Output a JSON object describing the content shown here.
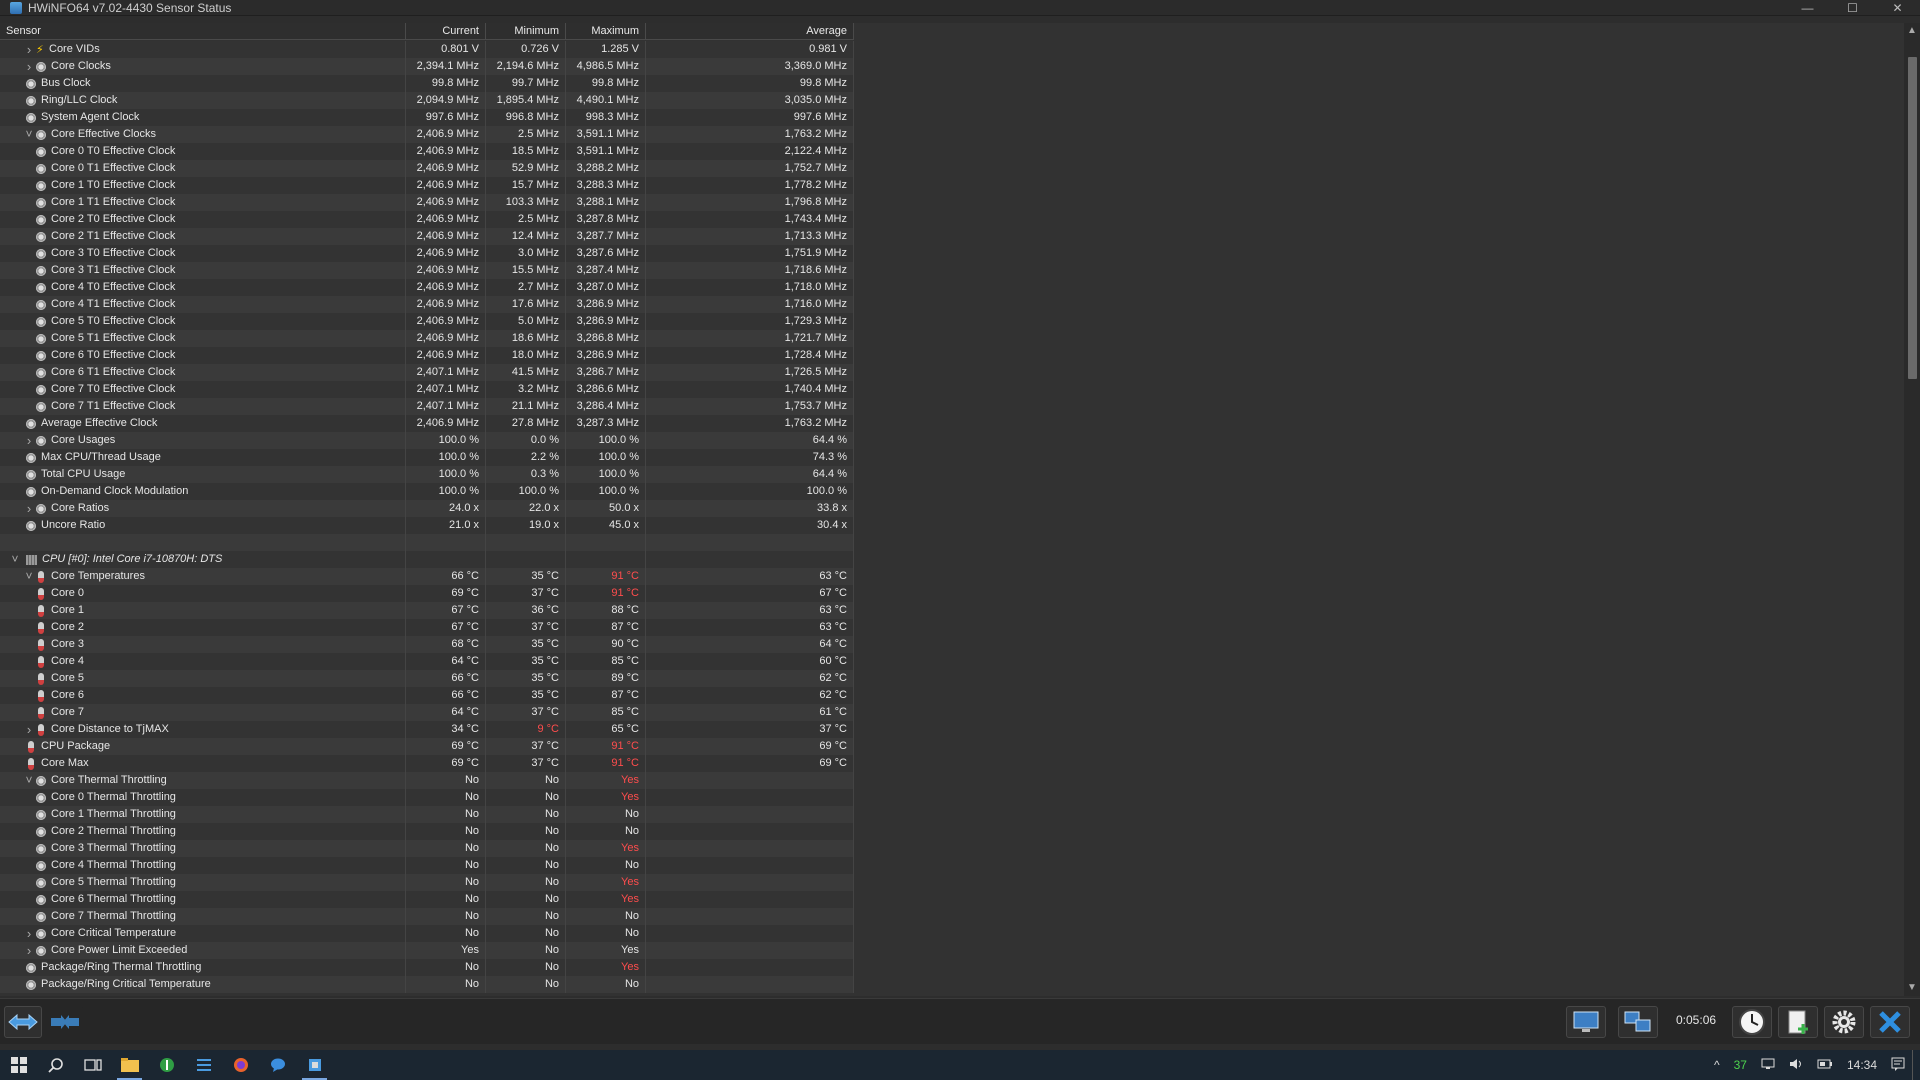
{
  "window": {
    "title": "HWiNFO64 v7.02-4430 Sensor Status",
    "minimize": "—",
    "maximize": "☐",
    "close": "✕"
  },
  "columns": [
    "Sensor",
    "Current",
    "Minimum",
    "Maximum",
    "Average"
  ],
  "rows": [
    {
      "label": "Core VIDs",
      "indent": 1,
      "expander": "right",
      "icon": "volt",
      "cur": "0.801 V",
      "min": "0.726 V",
      "max": "1.285 V",
      "avg": "0.981 V"
    },
    {
      "label": "Core Clocks",
      "indent": 1,
      "expander": "right",
      "icon": "clock",
      "cur": "2,394.1 MHz",
      "min": "2,194.6 MHz",
      "max": "4,986.5 MHz",
      "avg": "3,369.0 MHz"
    },
    {
      "label": "Bus Clock",
      "indent": 0,
      "icon": "clock",
      "cur": "99.8 MHz",
      "min": "99.7 MHz",
      "max": "99.8 MHz",
      "avg": "99.8 MHz"
    },
    {
      "label": "Ring/LLC Clock",
      "indent": 0,
      "icon": "clock",
      "cur": "2,094.9 MHz",
      "min": "1,895.4 MHz",
      "max": "4,490.1 MHz",
      "avg": "3,035.0 MHz"
    },
    {
      "label": "System Agent Clock",
      "indent": 0,
      "icon": "clock",
      "cur": "997.6 MHz",
      "min": "996.8 MHz",
      "max": "998.3 MHz",
      "avg": "997.6 MHz"
    },
    {
      "label": "Core Effective Clocks",
      "indent": 1,
      "expander": "down",
      "icon": "clock",
      "cur": "2,406.9 MHz",
      "min": "2.5 MHz",
      "max": "3,591.1 MHz",
      "avg": "1,763.2 MHz"
    },
    {
      "label": "Core 0 T0 Effective Clock",
      "indent": 2,
      "icon": "clock",
      "cur": "2,406.9 MHz",
      "min": "18.5 MHz",
      "max": "3,591.1 MHz",
      "avg": "2,122.4 MHz"
    },
    {
      "label": "Core 0 T1 Effective Clock",
      "indent": 2,
      "icon": "clock",
      "cur": "2,406.9 MHz",
      "min": "52.9 MHz",
      "max": "3,288.2 MHz",
      "avg": "1,752.7 MHz"
    },
    {
      "label": "Core 1 T0 Effective Clock",
      "indent": 2,
      "icon": "clock",
      "cur": "2,406.9 MHz",
      "min": "15.7 MHz",
      "max": "3,288.3 MHz",
      "avg": "1,778.2 MHz"
    },
    {
      "label": "Core 1 T1 Effective Clock",
      "indent": 2,
      "icon": "clock",
      "cur": "2,406.9 MHz",
      "min": "103.3 MHz",
      "max": "3,288.1 MHz",
      "avg": "1,796.8 MHz"
    },
    {
      "label": "Core 2 T0 Effective Clock",
      "indent": 2,
      "icon": "clock",
      "cur": "2,406.9 MHz",
      "min": "2.5 MHz",
      "max": "3,287.8 MHz",
      "avg": "1,743.4 MHz"
    },
    {
      "label": "Core 2 T1 Effective Clock",
      "indent": 2,
      "icon": "clock",
      "cur": "2,406.9 MHz",
      "min": "12.4 MHz",
      "max": "3,287.7 MHz",
      "avg": "1,713.3 MHz"
    },
    {
      "label": "Core 3 T0 Effective Clock",
      "indent": 2,
      "icon": "clock",
      "cur": "2,406.9 MHz",
      "min": "3.0 MHz",
      "max": "3,287.6 MHz",
      "avg": "1,751.9 MHz"
    },
    {
      "label": "Core 3 T1 Effective Clock",
      "indent": 2,
      "icon": "clock",
      "cur": "2,406.9 MHz",
      "min": "15.5 MHz",
      "max": "3,287.4 MHz",
      "avg": "1,718.6 MHz"
    },
    {
      "label": "Core 4 T0 Effective Clock",
      "indent": 2,
      "icon": "clock",
      "cur": "2,406.9 MHz",
      "min": "2.7 MHz",
      "max": "3,287.0 MHz",
      "avg": "1,718.0 MHz"
    },
    {
      "label": "Core 4 T1 Effective Clock",
      "indent": 2,
      "icon": "clock",
      "cur": "2,406.9 MHz",
      "min": "17.6 MHz",
      "max": "3,286.9 MHz",
      "avg": "1,716.0 MHz"
    },
    {
      "label": "Core 5 T0 Effective Clock",
      "indent": 2,
      "icon": "clock",
      "cur": "2,406.9 MHz",
      "min": "5.0 MHz",
      "max": "3,286.9 MHz",
      "avg": "1,729.3 MHz"
    },
    {
      "label": "Core 5 T1 Effective Clock",
      "indent": 2,
      "icon": "clock",
      "cur": "2,406.9 MHz",
      "min": "18.6 MHz",
      "max": "3,286.8 MHz",
      "avg": "1,721.7 MHz"
    },
    {
      "label": "Core 6 T0 Effective Clock",
      "indent": 2,
      "icon": "clock",
      "cur": "2,406.9 MHz",
      "min": "18.0 MHz",
      "max": "3,286.9 MHz",
      "avg": "1,728.4 MHz"
    },
    {
      "label": "Core 6 T1 Effective Clock",
      "indent": 2,
      "icon": "clock",
      "cur": "2,407.1 MHz",
      "min": "41.5 MHz",
      "max": "3,286.7 MHz",
      "avg": "1,726.5 MHz"
    },
    {
      "label": "Core 7 T0 Effective Clock",
      "indent": 2,
      "icon": "clock",
      "cur": "2,407.1 MHz",
      "min": "3.2 MHz",
      "max": "3,286.6 MHz",
      "avg": "1,740.4 MHz"
    },
    {
      "label": "Core 7 T1 Effective Clock",
      "indent": 2,
      "icon": "clock",
      "cur": "2,407.1 MHz",
      "min": "21.1 MHz",
      "max": "3,286.4 MHz",
      "avg": "1,753.7 MHz"
    },
    {
      "label": "Average Effective Clock",
      "indent": 0,
      "icon": "clock",
      "cur": "2,406.9 MHz",
      "min": "27.8 MHz",
      "max": "3,287.3 MHz",
      "avg": "1,763.2 MHz"
    },
    {
      "label": "Core Usages",
      "indent": 1,
      "expander": "right",
      "icon": "clock",
      "cur": "100.0 %",
      "min": "0.0 %",
      "max": "100.0 %",
      "avg": "64.4 %"
    },
    {
      "label": "Max CPU/Thread Usage",
      "indent": 0,
      "icon": "clock",
      "cur": "100.0 %",
      "min": "2.2 %",
      "max": "100.0 %",
      "avg": "74.3 %"
    },
    {
      "label": "Total CPU Usage",
      "indent": 0,
      "icon": "clock",
      "cur": "100.0 %",
      "min": "0.3 %",
      "max": "100.0 %",
      "avg": "64.4 %"
    },
    {
      "label": "On-Demand Clock Modulation",
      "indent": 0,
      "icon": "clock",
      "cur": "100.0 %",
      "min": "100.0 %",
      "max": "100.0 %",
      "avg": "100.0 %"
    },
    {
      "label": "Core Ratios",
      "indent": 1,
      "expander": "right",
      "icon": "clock",
      "cur": "24.0 x",
      "min": "22.0 x",
      "max": "50.0 x",
      "avg": "33.8 x"
    },
    {
      "label": "Uncore Ratio",
      "indent": 0,
      "icon": "clock",
      "cur": "21.0 x",
      "min": "19.0 x",
      "max": "45.0 x",
      "avg": "30.4 x"
    },
    {
      "label": "",
      "indent": 0,
      "icon": "none",
      "cur": "",
      "min": "",
      "max": "",
      "avg": ""
    },
    {
      "label": "CPU [#0]: Intel Core i7-10870H: DTS",
      "indent": 0,
      "expander": "down-group",
      "icon": "chip",
      "italic": true,
      "cur": "",
      "min": "",
      "max": "",
      "avg": ""
    },
    {
      "label": "Core Temperatures",
      "indent": 1,
      "expander": "down",
      "icon": "therm",
      "cur": "66 °C",
      "min": "35 °C",
      "max": "91 °C",
      "maxRed": true,
      "avg": "63 °C"
    },
    {
      "label": "Core 0",
      "indent": 2,
      "icon": "therm",
      "cur": "69 °C",
      "min": "37 °C",
      "max": "91 °C",
      "maxRed": true,
      "avg": "67 °C"
    },
    {
      "label": "Core 1",
      "indent": 2,
      "icon": "therm",
      "cur": "67 °C",
      "min": "36 °C",
      "max": "88 °C",
      "avg": "63 °C"
    },
    {
      "label": "Core 2",
      "indent": 2,
      "icon": "therm",
      "cur": "67 °C",
      "min": "37 °C",
      "max": "87 °C",
      "avg": "63 °C"
    },
    {
      "label": "Core 3",
      "indent": 2,
      "icon": "therm",
      "cur": "68 °C",
      "min": "35 °C",
      "max": "90 °C",
      "avg": "64 °C"
    },
    {
      "label": "Core 4",
      "indent": 2,
      "icon": "therm",
      "cur": "64 °C",
      "min": "35 °C",
      "max": "85 °C",
      "avg": "60 °C"
    },
    {
      "label": "Core 5",
      "indent": 2,
      "icon": "therm",
      "cur": "66 °C",
      "min": "35 °C",
      "max": "89 °C",
      "avg": "62 °C"
    },
    {
      "label": "Core 6",
      "indent": 2,
      "icon": "therm",
      "cur": "66 °C",
      "min": "35 °C",
      "max": "87 °C",
      "avg": "62 °C"
    },
    {
      "label": "Core 7",
      "indent": 2,
      "icon": "therm",
      "cur": "64 °C",
      "min": "37 °C",
      "max": "85 °C",
      "avg": "61 °C"
    },
    {
      "label": "Core Distance to TjMAX",
      "indent": 1,
      "expander": "right",
      "icon": "therm",
      "cur": "34 °C",
      "min": "9 °C",
      "minRed": true,
      "max": "65 °C",
      "avg": "37 °C"
    },
    {
      "label": "CPU Package",
      "indent": 0,
      "icon": "therm",
      "cur": "69 °C",
      "min": "37 °C",
      "max": "91 °C",
      "maxRed": true,
      "avg": "69 °C"
    },
    {
      "label": "Core Max",
      "indent": 0,
      "icon": "therm",
      "cur": "69 °C",
      "min": "37 °C",
      "max": "91 °C",
      "maxRed": true,
      "avg": "69 °C"
    },
    {
      "label": "Core Thermal Throttling",
      "indent": 1,
      "expander": "down",
      "icon": "clock",
      "cur": "No",
      "min": "No",
      "max": "Yes",
      "maxRed": true,
      "avg": ""
    },
    {
      "label": "Core 0 Thermal Throttling",
      "indent": 2,
      "icon": "clock",
      "cur": "No",
      "min": "No",
      "max": "Yes",
      "maxRed": true,
      "avg": ""
    },
    {
      "label": "Core 1 Thermal Throttling",
      "indent": 2,
      "icon": "clock",
      "cur": "No",
      "min": "No",
      "max": "No",
      "avg": ""
    },
    {
      "label": "Core 2 Thermal Throttling",
      "indent": 2,
      "icon": "clock",
      "cur": "No",
      "min": "No",
      "max": "No",
      "avg": ""
    },
    {
      "label": "Core 3 Thermal Throttling",
      "indent": 2,
      "icon": "clock",
      "cur": "No",
      "min": "No",
      "max": "Yes",
      "maxRed": true,
      "avg": ""
    },
    {
      "label": "Core 4 Thermal Throttling",
      "indent": 2,
      "icon": "clock",
      "cur": "No",
      "min": "No",
      "max": "No",
      "avg": ""
    },
    {
      "label": "Core 5 Thermal Throttling",
      "indent": 2,
      "icon": "clock",
      "cur": "No",
      "min": "No",
      "max": "Yes",
      "maxRed": true,
      "avg": ""
    },
    {
      "label": "Core 6 Thermal Throttling",
      "indent": 2,
      "icon": "clock",
      "cur": "No",
      "min": "No",
      "max": "Yes",
      "maxRed": true,
      "avg": ""
    },
    {
      "label": "Core 7 Thermal Throttling",
      "indent": 2,
      "icon": "clock",
      "cur": "No",
      "min": "No",
      "max": "No",
      "avg": ""
    },
    {
      "label": "Core Critical Temperature",
      "indent": 1,
      "expander": "right",
      "icon": "clock",
      "cur": "No",
      "min": "No",
      "max": "No",
      "avg": ""
    },
    {
      "label": "Core Power Limit Exceeded",
      "indent": 1,
      "expander": "right",
      "icon": "clock",
      "cur": "Yes",
      "min": "No",
      "max": "Yes",
      "avg": ""
    },
    {
      "label": "Package/Ring Thermal Throttling",
      "indent": 0,
      "icon": "clock",
      "cur": "No",
      "min": "No",
      "max": "Yes",
      "maxRed": true,
      "avg": ""
    },
    {
      "label": "Package/Ring Critical Temperature",
      "indent": 0,
      "icon": "clock",
      "cur": "No",
      "min": "No",
      "max": "No",
      "avg": ""
    }
  ],
  "toolbar": {
    "timer": "0:05:06"
  },
  "taskbar": {
    "tray_temp": "37",
    "clock": "14:34"
  },
  "colors": {
    "background": "#2d2d2d",
    "alert_red": "#ff4d4d",
    "taskbar": "#1b2631"
  }
}
